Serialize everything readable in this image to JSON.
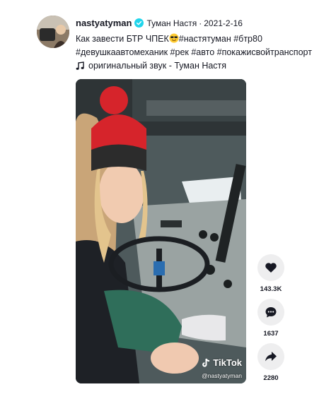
{
  "author": {
    "username": "nastyatyman",
    "nickname": "Туман Настя",
    "separator": "·",
    "date": "2021-2-16",
    "verified_color": "#20d5ec"
  },
  "caption": {
    "text_before_emoji": "Как завести БТР ЧПЕК",
    "emoji": "smiling-face-with-sunglasses",
    "text_after_emoji": "#настятуман #бтр80 #девушкаавтомеханик #рек #авто #покажисвойтранспорт"
  },
  "sound": {
    "icon": "music-note-icon",
    "label": "оригинальный звук - Туман Настя"
  },
  "video": {
    "watermark_brand": "TikTok",
    "watermark_handle": "@nastyatyman"
  },
  "actions": {
    "like": {
      "icon": "heart-icon",
      "count": "143.3K"
    },
    "comment": {
      "icon": "comment-icon",
      "count": "1637"
    },
    "share": {
      "icon": "share-icon",
      "count": "2280"
    }
  },
  "colors": {
    "text": "#161823",
    "action_bg": "#eeeeef"
  }
}
